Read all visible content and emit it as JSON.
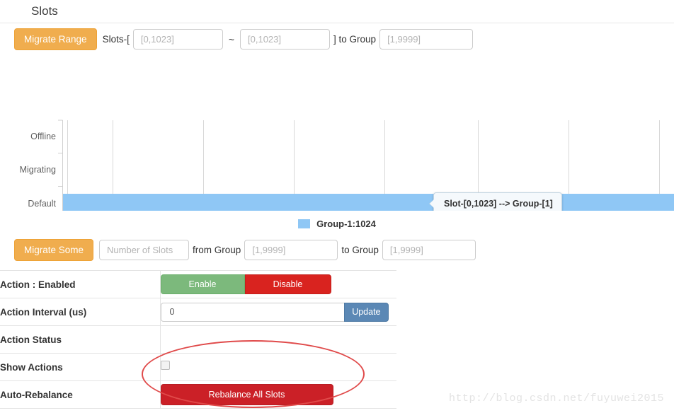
{
  "header": {
    "title": "Slots"
  },
  "migrate_range": {
    "button_label": "Migrate Range",
    "label_slots": "Slots-[",
    "from_placeholder": "[0,1023]",
    "from_value": "",
    "tilde": "~",
    "to_placeholder": "[0,1023]",
    "to_value": "",
    "label_bracket_to_group": "] to Group",
    "group_placeholder": "[1,9999]",
    "group_value": ""
  },
  "chart_data": {
    "type": "bar",
    "orientation": "horizontal",
    "title": "",
    "xlabel": "",
    "ylabel": "",
    "categories": [
      "Offline",
      "Migrating",
      "Default"
    ],
    "series": [
      {
        "name": "Group-1",
        "values": [
          0,
          0,
          1024
        ],
        "color": "#8fc7f5"
      }
    ],
    "xticks": [
      0,
      64,
      128,
      192,
      256,
      320,
      384,
      448,
      512,
      576,
      640,
      704,
      768,
      832
    ],
    "xlim": [
      0,
      864
    ],
    "visible_x_max": 832,
    "grid": "vertical-major",
    "legend": {
      "position": "bottom",
      "entries": [
        "Group-1:1024"
      ]
    },
    "tooltip": "Slot-[0,1023] --> Group-[1]"
  },
  "migrate_some": {
    "button_label": "Migrate Some",
    "number_placeholder": "Number of Slots",
    "number_value": "",
    "label_from_group": "from Group",
    "from_group_placeholder": "[1,9999]",
    "from_group_value": "",
    "label_to_group": "to Group",
    "to_group_placeholder": "[1,9999]",
    "to_group_value": ""
  },
  "settings": {
    "rows": [
      {
        "label": "Action : Enabled"
      },
      {
        "label": "Action Interval (us)"
      },
      {
        "label": "Action Status",
        "value": ""
      },
      {
        "label": "Show Actions"
      },
      {
        "label": "Auto-Rebalance"
      }
    ],
    "enable_label": "Enable",
    "disable_label": "Disable",
    "interval_value": "0",
    "update_label": "Update",
    "show_actions_checked": false,
    "rebalance_label": "Rebalance All Slots"
  },
  "watermark": {
    "text": "http://blog.csdn.net/fuyuwei2015"
  },
  "colors": {
    "bar": "#8fc7f5",
    "warning": "#f0ad4e",
    "success": "#7cb97c",
    "danger": "#d9231f",
    "rebalance": "#cb2027",
    "update": "#5b88b5",
    "annotation": "#e04a4a"
  }
}
